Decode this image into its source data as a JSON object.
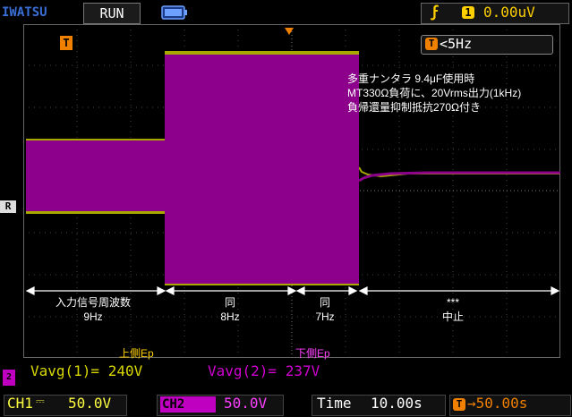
{
  "top_bar": {
    "brand": "IWATSU",
    "run_state": "RUN",
    "battery_icon": "battery-icon",
    "trigger_edge_icon": "rising-edge-icon",
    "trigger_source": "1",
    "trigger_level": "0.00uV"
  },
  "screen": {
    "trigger_pos_marker": "T",
    "freq_marker": "T",
    "frequency_text": "<5Hz",
    "ref_marker": "R",
    "notes": [
      "多重ナンタラ 9.4μF使用時",
      "MT330Ω負荷に、20Vrms出力(1kHz)",
      "負帰還量抑制抵抗270Ω付き"
    ],
    "segments": [
      {
        "label": "入力信号周波数",
        "value": "9Hz"
      },
      {
        "label": "同",
        "value": "8Hz"
      },
      {
        "label": "同",
        "value": "7Hz"
      },
      {
        "label": "***",
        "value": "中止"
      }
    ],
    "ep_upper_label": "上側Ep",
    "ep_lower_label": "下側Ep",
    "meas1": "Vavg(1)= 240V",
    "meas2": "Vavg(2)= 237V",
    "ch2_ground_marker": "2"
  },
  "bottom_bar": {
    "ch1_label": "CH1",
    "ch1_coupling": "⎓",
    "ch1_scale": "50.0V",
    "ch2_label": "CH2",
    "ch2_coupling": "⎓",
    "ch2_scale": "50.0V",
    "time_label": "Time",
    "time_value": "10.00s",
    "pos_icon": "T",
    "pos_value": "→50.00s"
  },
  "colors": {
    "ch1": "#a8a800",
    "ch2": "#8c008c",
    "accent_orange": "#f08000",
    "trigger_yellow": "#ffd000",
    "meas_yellow": "#d8d800",
    "meas_magenta": "#d000d0",
    "grid": "#555555"
  }
}
